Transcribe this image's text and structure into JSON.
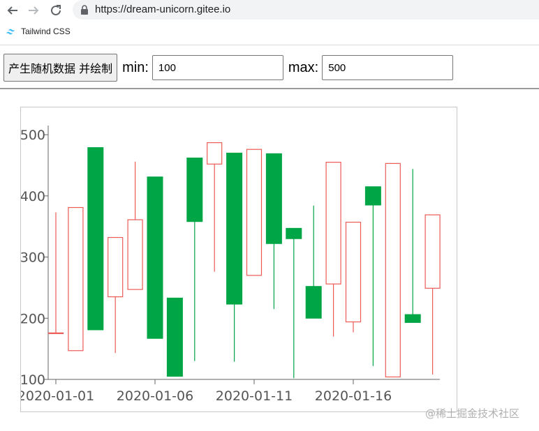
{
  "browser": {
    "url": "https://dream-unicorn.gitee.io",
    "bookmark_label": "Tailwind CSS"
  },
  "controls": {
    "generate_label": "产生随机数据 并绘制",
    "min_label": "min:",
    "min_value": "100",
    "max_label": "max:",
    "max_value": "500"
  },
  "watermark": "@稀土掘金技术社区",
  "colors": {
    "up": "#ec5b56",
    "down": "#00a545",
    "axis": "#666666"
  },
  "chart_data": {
    "type": "candlestick",
    "title": "",
    "xlabel": "",
    "ylabel": "",
    "ylim": [
      100,
      515
    ],
    "yticks": [
      100,
      200,
      300,
      400,
      500
    ],
    "x_tick_labels": [
      "2020-01-01",
      "2020-01-06",
      "2020-01-11",
      "2020-01-16"
    ],
    "dates": [
      "2020-01-01",
      "2020-01-02",
      "2020-01-03",
      "2020-01-04",
      "2020-01-05",
      "2020-01-06",
      "2020-01-07",
      "2020-01-08",
      "2020-01-09",
      "2020-01-10",
      "2020-01-11",
      "2020-01-12",
      "2020-01-13",
      "2020-01-14",
      "2020-01-15",
      "2020-01-16",
      "2020-01-17",
      "2020-01-18",
      "2020-01-19",
      "2020-01-20"
    ],
    "series": [
      {
        "open": 176,
        "close": 176,
        "low": 176,
        "high": 373
      },
      {
        "open": 147,
        "close": 381,
        "low": 147,
        "high": 381
      },
      {
        "open": 479,
        "close": 181,
        "low": 181,
        "high": 479
      },
      {
        "open": 235,
        "close": 332,
        "low": 143,
        "high": 332
      },
      {
        "open": 247,
        "close": 361,
        "low": 247,
        "high": 456
      },
      {
        "open": 431,
        "close": 167,
        "low": 167,
        "high": 431
      },
      {
        "open": 233,
        "close": 105,
        "low": 105,
        "high": 233
      },
      {
        "open": 462,
        "close": 358,
        "low": 130,
        "high": 462
      },
      {
        "open": 452,
        "close": 487,
        "low": 276,
        "high": 487
      },
      {
        "open": 470,
        "close": 223,
        "low": 129,
        "high": 470
      },
      {
        "open": 270,
        "close": 476,
        "low": 270,
        "high": 476
      },
      {
        "open": 469,
        "close": 322,
        "low": 215,
        "high": 469
      },
      {
        "open": 347,
        "close": 330,
        "low": 102,
        "high": 347
      },
      {
        "open": 252,
        "close": 200,
        "low": 200,
        "high": 384
      },
      {
        "open": 256,
        "close": 455,
        "low": 170,
        "high": 455
      },
      {
        "open": 194,
        "close": 357,
        "low": 177,
        "high": 357
      },
      {
        "open": 415,
        "close": 385,
        "low": 122,
        "high": 415
      },
      {
        "open": 104,
        "close": 453,
        "low": 104,
        "high": 453
      },
      {
        "open": 206,
        "close": 193,
        "low": 193,
        "high": 444
      },
      {
        "open": 249,
        "close": 369,
        "low": 108,
        "high": 369
      }
    ]
  }
}
